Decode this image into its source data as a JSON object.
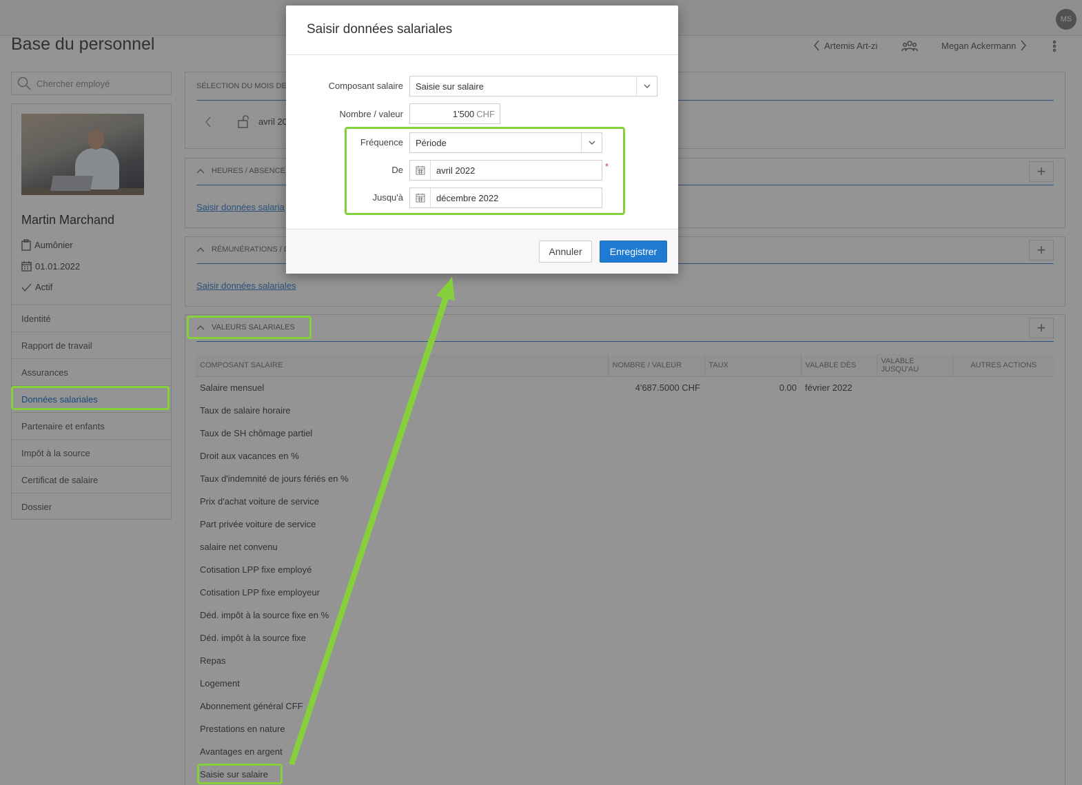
{
  "header": {
    "avatar_initials": "MS",
    "page_title": "Base du personnel",
    "prev_employee": "Artemis Art-zi",
    "next_employee": "Megan Ackermann"
  },
  "sidebar": {
    "search_placeholder": "Chercher employé",
    "employee": {
      "name": "Martin Marchand",
      "role": "Aumônier",
      "date": "01.01.2022",
      "status": "Actif"
    },
    "items": [
      {
        "label": "Identité"
      },
      {
        "label": "Rapport de travail"
      },
      {
        "label": "Assurances"
      },
      {
        "label": "Données salariales"
      },
      {
        "label": "Partenaire et enfants"
      },
      {
        "label": "Impôt à la source"
      },
      {
        "label": "Certificat de salaire"
      },
      {
        "label": "Dossier"
      }
    ],
    "active_item": "Données salariales"
  },
  "main": {
    "month_section_title": "SÉLECTION DU MOIS DES",
    "month_value": "avril 20",
    "hours_section_title": "HEURES / ABSENCE",
    "hours_link": "Saisir données salaria",
    "remun_section_title": "RÉMUNÉRATIONS / D",
    "remun_link": "Saisir données salariales",
    "values_section_title": "VALEURS SALARIALES",
    "table": {
      "columns": [
        "COMPOSANT SALAIRE",
        "NOMBRE / VALEUR",
        "TAUX",
        "VALABLE DÈS",
        "VALABLE JUSQU'AU",
        "AUTRES ACTIONS"
      ],
      "rows": [
        {
          "name": "Salaire mensuel",
          "value": "4'687.5000 CHF",
          "rate": "0.00",
          "from": "février 2022"
        },
        {
          "name": "Taux de salaire horaire"
        },
        {
          "name": "Taux de SH chômage partiel"
        },
        {
          "name": "Droit aux vacances en %"
        },
        {
          "name": "Taux d'indemnité de jours fériés en %"
        },
        {
          "name": "Prix d'achat voiture de service"
        },
        {
          "name": "Part privée voiture de service"
        },
        {
          "name": "salaire net convenu"
        },
        {
          "name": "Cotisation LPP fixe employé"
        },
        {
          "name": "Cotisation LPP fixe employeur"
        },
        {
          "name": "Déd. impôt à la source fixe en %"
        },
        {
          "name": "Déd. impôt à la source fixe"
        },
        {
          "name": "Repas"
        },
        {
          "name": "Logement"
        },
        {
          "name": "Abonnement général CFF"
        },
        {
          "name": "Prestations en nature"
        },
        {
          "name": "Avantages en argent"
        },
        {
          "name": "Saisie sur salaire"
        }
      ]
    }
  },
  "modal": {
    "title": "Saisir données salariales",
    "component_label": "Composant salaire",
    "component_value": "Saisie sur salaire",
    "amount_label": "Nombre / valeur",
    "amount_value": "1'500",
    "amount_unit": "CHF",
    "frequency_label": "Fréquence",
    "frequency_value": "Période",
    "from_label": "De",
    "from_value": "avril 2022",
    "required_mark": "*",
    "to_label": "Jusqu'à",
    "to_value": "décembre 2022",
    "cancel_label": "Annuler",
    "save_label": "Enregistrer"
  },
  "colors": {
    "highlight": "#86d03c",
    "primary": "#1f7ad1",
    "link": "#4a8cd4"
  }
}
